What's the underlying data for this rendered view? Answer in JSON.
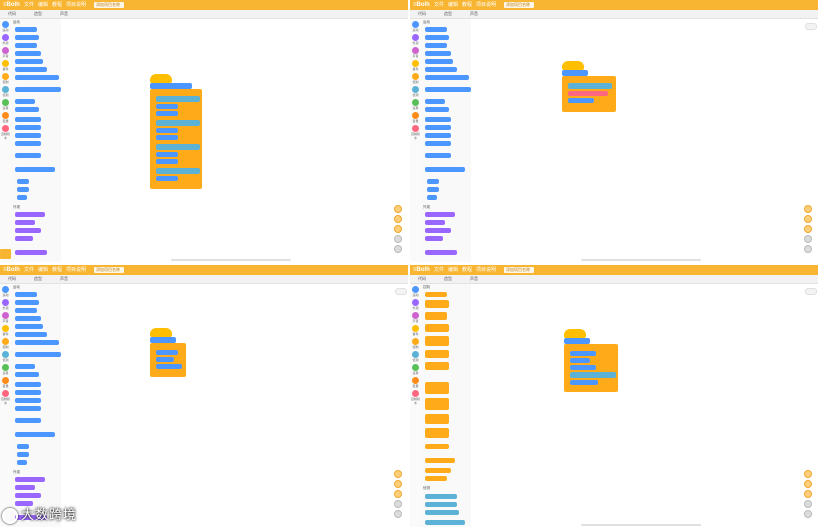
{
  "app": {
    "logo": "≡Bolh",
    "menu": [
      "文件",
      "编辑",
      "教程",
      "项目说明"
    ],
    "project_name": "添加项目名称",
    "tabs": [
      "代码",
      "造型",
      "声音"
    ]
  },
  "categories": [
    {
      "label": "运动",
      "color": "#4c97ff"
    },
    {
      "label": "外观",
      "color": "#9966ff"
    },
    {
      "label": "声音",
      "color": "#cf63cf"
    },
    {
      "label": "事件",
      "color": "#ffbf00"
    },
    {
      "label": "控制",
      "color": "#ffab19"
    },
    {
      "label": "侦测",
      "color": "#5cb1d6"
    },
    {
      "label": "运算",
      "color": "#59c059"
    },
    {
      "label": "变量",
      "color": "#ff8c1a"
    },
    {
      "label": "自制积木",
      "color": "#ff6680"
    }
  ],
  "palette_sections": {
    "motion": "运动",
    "looks": "外观",
    "control": "控制",
    "sensing": "侦测"
  },
  "colors": {
    "menubar": "#f7b531",
    "motion": "#4c97ff",
    "looks": "#9966ff",
    "events": "#ffbf00",
    "control": "#ffab19",
    "sensing": "#5cb1d6",
    "custom": "#ff6680"
  },
  "watermark": "大数跨境"
}
